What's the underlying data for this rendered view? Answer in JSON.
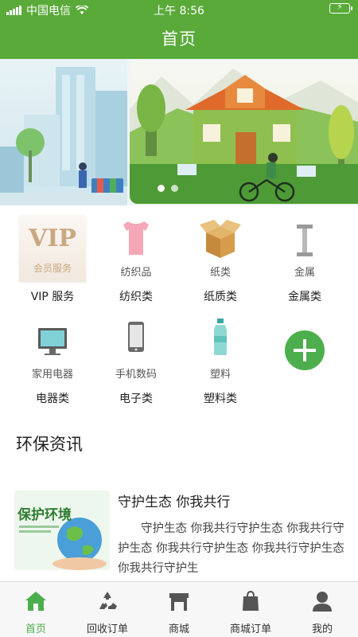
{
  "status_bar": {
    "carrier": "中国电信",
    "time": "上午 8:56"
  },
  "nav": {
    "title": "首页"
  },
  "categories": [
    {
      "label": "VIP 服务",
      "sub": "会员服务",
      "badge": "VIP",
      "icon": "vip-card"
    },
    {
      "label": "纺织类",
      "sub": "纺织品",
      "icon": "tshirt-icon"
    },
    {
      "label": "纸质类",
      "sub": "纸类",
      "icon": "cardboard-box-icon"
    },
    {
      "label": "金属类",
      "sub": "金属",
      "icon": "metal-beam-icon"
    },
    {
      "label": "电器类",
      "sub": "家用电器",
      "icon": "monitor-icon"
    },
    {
      "label": "电子类",
      "sub": "手机数码",
      "icon": "phone-icon"
    },
    {
      "label": "塑料类",
      "sub": "塑料",
      "icon": "plastic-bottle-icon"
    },
    {
      "label": "",
      "icon": "plus-icon"
    }
  ],
  "news": {
    "section_title": "环保资讯",
    "items": [
      {
        "title": "守护生态 你我共行",
        "body": "守护生态 你我共行守护生态 你我共行守护生态 你我共行守护生态 你我共行守护生态 你我共行守护生",
        "thumb_text": "保护环境"
      }
    ]
  },
  "tabs": [
    {
      "label": "首页",
      "icon": "home-icon",
      "active": true
    },
    {
      "label": "回收订单",
      "icon": "recycle-icon",
      "active": false
    },
    {
      "label": "商城",
      "icon": "store-icon",
      "active": false
    },
    {
      "label": "商城订单",
      "icon": "shopping-bag-icon",
      "active": false
    },
    {
      "label": "我的",
      "icon": "user-icon",
      "active": false
    }
  ],
  "colors": {
    "primary": "#5aaa3a",
    "accent": "#4cae4c",
    "vip_gold": "#c9a881"
  }
}
